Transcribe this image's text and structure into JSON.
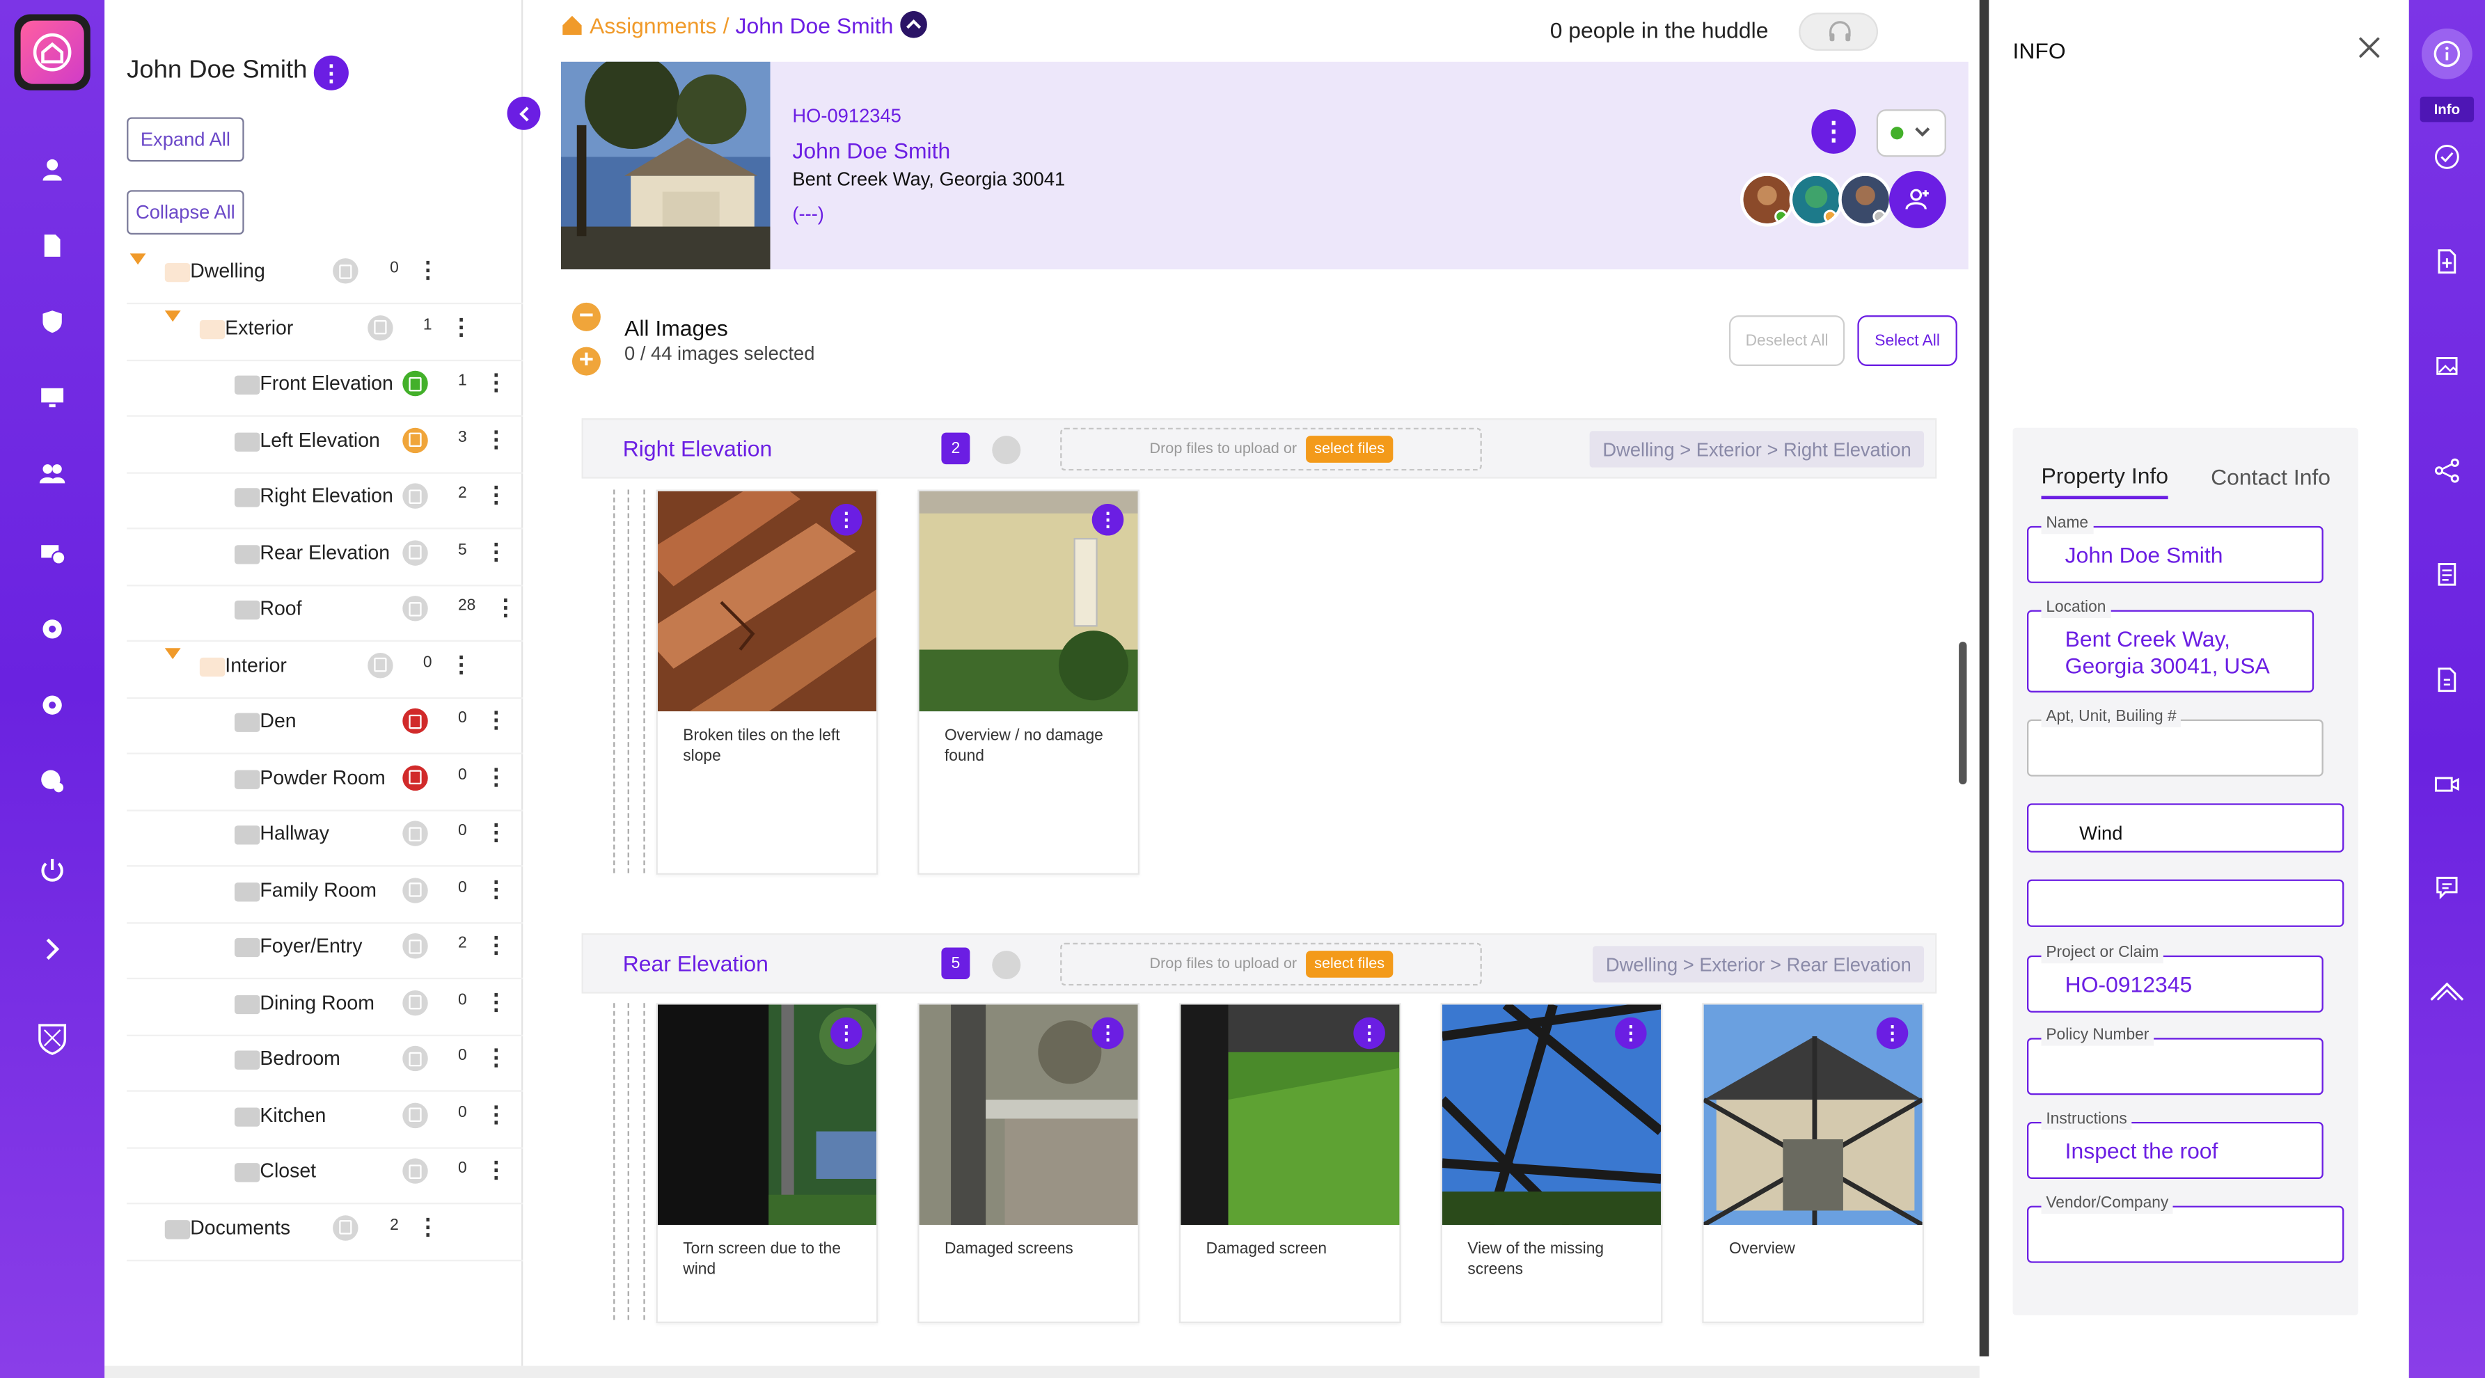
{
  "breadcrumb": {
    "root": "Assignments",
    "separator": "/",
    "current": "John Doe Smith"
  },
  "huddle": {
    "text": "0 people in the huddle"
  },
  "tree": {
    "title": "John Doe Smith",
    "expand_all": "Expand All",
    "collapse_all": "Collapse All",
    "items": [
      {
        "label": "Dwelling",
        "count": "0",
        "status": "gray"
      },
      {
        "label": "Exterior",
        "count": "1",
        "status": "gray"
      },
      {
        "label": "Front Elevation",
        "count": "1",
        "status": "green"
      },
      {
        "label": "Left Elevation",
        "count": "3",
        "status": "orange"
      },
      {
        "label": "Right Elevation",
        "count": "2",
        "status": "gray"
      },
      {
        "label": "Rear Elevation",
        "count": "5",
        "status": "gray"
      },
      {
        "label": "Roof",
        "count": "28",
        "status": "gray"
      },
      {
        "label": "Interior",
        "count": "0",
        "status": "gray"
      },
      {
        "label": "Den",
        "count": "0",
        "status": "red"
      },
      {
        "label": "Powder Room",
        "count": "0",
        "status": "red"
      },
      {
        "label": "Hallway",
        "count": "0",
        "status": "gray"
      },
      {
        "label": "Family Room",
        "count": "0",
        "status": "gray"
      },
      {
        "label": "Foyer/Entry",
        "count": "2",
        "status": "gray"
      },
      {
        "label": "Dining Room",
        "count": "0",
        "status": "gray"
      },
      {
        "label": "Bedroom",
        "count": "0",
        "status": "gray"
      },
      {
        "label": "Kitchen",
        "count": "0",
        "status": "gray"
      },
      {
        "label": "Closet",
        "count": "0",
        "status": "gray"
      },
      {
        "label": "Documents",
        "count": "2",
        "status": "gray"
      }
    ]
  },
  "header": {
    "claim_id": "HO-0912345",
    "name": "John Doe Smith",
    "address": "Bent Creek Way, Georgia 30041",
    "phone": "(---)"
  },
  "images": {
    "title": "All Images",
    "selected": "0 / 44 images selected",
    "deselect_all": "Deselect All",
    "select_all": "Select All",
    "drop_text": "Drop files to upload or",
    "select_files": "select files",
    "sections": [
      {
        "title": "Right Elevation",
        "count": "2",
        "path": "Dwelling > Exterior > Right Elevation",
        "cards": [
          {
            "caption": "Broken tiles on the left slope",
            "photo": "roof-tiles"
          },
          {
            "caption": "Overview / no damage found",
            "photo": "wall"
          }
        ]
      },
      {
        "title": "Rear Elevation",
        "count": "5",
        "path": "Dwelling > Exterior > Rear Elevation",
        "cards": [
          {
            "caption": "Torn screen due to the wind",
            "photo": "torn-screen"
          },
          {
            "caption": "Damaged screens",
            "photo": "screen-frame"
          },
          {
            "caption": "Damaged screen",
            "photo": "grass"
          },
          {
            "caption": "View of the missing screens",
            "photo": "sky-frame"
          },
          {
            "caption": "Overview",
            "photo": "house"
          }
        ]
      }
    ]
  },
  "info": {
    "title": "INFO",
    "tab_property": "Property Info",
    "tab_contact": "Contact Info",
    "name_label": "Name",
    "name_value": "John Doe Smith",
    "location_label": "Location",
    "location_value": "Bent Creek Way, Georgia 30041, USA",
    "apt_label": "Apt, Unit, Builing #",
    "peril_value": "Wind",
    "project_label": "Project or Claim",
    "project_value": "HO-0912345",
    "policy_label": "Policy Number",
    "instructions_label": "Instructions",
    "instructions_value": "Inspect the roof",
    "vendor_label": "Vendor/Company"
  },
  "right_rail": {
    "info_label": "Info"
  },
  "colors": {
    "brand": "#6b1ee3",
    "accent": "#f09a2a",
    "status_green": "#43b02a",
    "status_orange": "#f0a53a",
    "status_red": "#d12a2a"
  }
}
